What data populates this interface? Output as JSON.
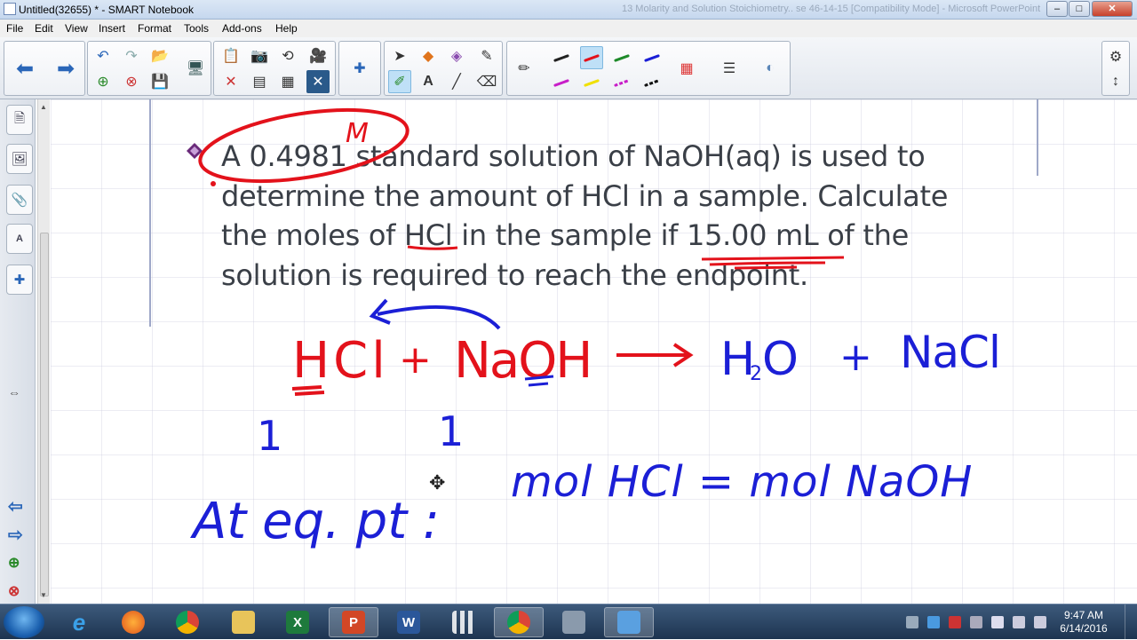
{
  "window": {
    "title": "Untitled(32655) * - SMART Notebook",
    "background_title": "13 Molarity and Solution Stoichiometry.. se 46-14-15 [Compatibility Mode] - Microsoft PowerPoint",
    "min": "–",
    "max": "□",
    "close": "✕"
  },
  "menu": [
    "File",
    "Edit",
    "View",
    "Insert",
    "Format",
    "Tools",
    "Add-ons",
    "Help"
  ],
  "toolbar": {
    "icons": [
      "back-icon",
      "forward-icon",
      "undo-icon",
      "redo-icon",
      "open-icon",
      "new-page-icon",
      "delete-page-icon",
      "save-icon",
      "screen-shade-icon",
      "paste-icon",
      "screen-capture-icon",
      "undo-redo-icon",
      "document-camera-icon",
      "delete-icon",
      "table-icon",
      "clear-page-icon",
      "addons-icon",
      "select-icon",
      "shapes-icon",
      "eraser-icon",
      "magic-pen-icon",
      "pens-icon",
      "text-icon",
      "line-icon",
      "eraser2-icon",
      "pen-properties-icon",
      "properties-icon",
      "colors-icon",
      "line-style-icon",
      "fill-icon",
      "settings-icon",
      "move-toolbar-icon"
    ],
    "pen_colors": [
      "#222222",
      "#e3121b",
      "#1e8a2a",
      "#1b1fd6",
      "#c81ec8",
      "#f0e000",
      "#c81ec8",
      "#111111"
    ]
  },
  "content": {
    "problem_line1": "A 0.4981 standard solution of NaOH(aq) is used to",
    "problem_line2": "determine the amount of HCl in a sample. Calculate",
    "problem_line3": "the moles of HCl in the sample if 15.00 mL of the",
    "problem_line4": "solution is required to reach the endpoint.",
    "ink_annotation_M": "M",
    "reaction_red": "HCl + NaOH →",
    "reaction_red_hcl": "HCl",
    "reaction_red_plus": "+",
    "reaction_red_naoh": "NaOH",
    "reaction_blue_h2o": "H",
    "reaction_blue_sub2": "2",
    "reaction_blue_o": "O",
    "reaction_blue_plus": "+",
    "reaction_blue_nacl": "NaCl",
    "coef_1": "1",
    "coef_2": "1",
    "at_eq_pt": "At eq. pt :",
    "equation": "mol HCl  =  mol NaOH"
  },
  "taskbar": {
    "items": [
      "internet-explorer",
      "firefox",
      "chrome",
      "file-explorer",
      "excel",
      "powerpoint",
      "word",
      "smart-apps",
      "chrome-2",
      "document-camera",
      "smart-notebook"
    ],
    "time": "9:47 AM",
    "date": "6/14/2016"
  },
  "colors": {
    "red_ink": "#e3121b",
    "blue_ink": "#1b1fd6",
    "text": "#3a3f47"
  }
}
